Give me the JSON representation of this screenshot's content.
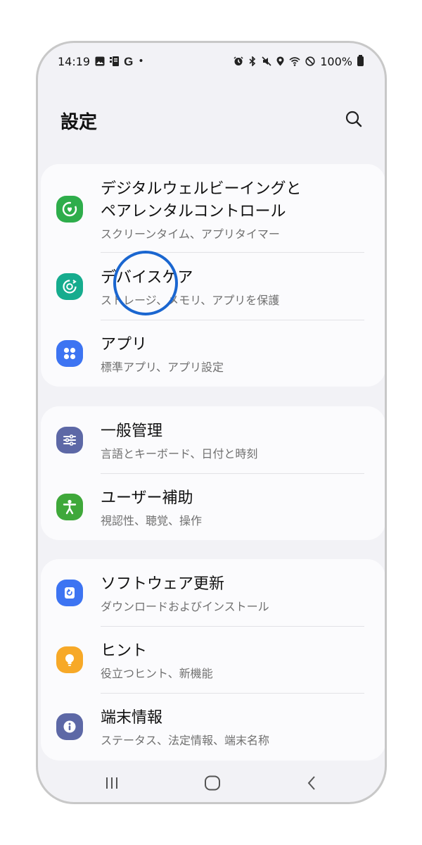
{
  "status_bar": {
    "time": "14:19",
    "carrier_glyph": "G",
    "dot": "•",
    "battery_pct": "100%",
    "icons_left": [
      "image-icon",
      "sim-icon",
      "google-icon",
      "dot-icon"
    ],
    "icons_right": [
      "alarm-icon",
      "bluetooth-icon",
      "mute-icon",
      "location-icon",
      "wifi-icon",
      "dnd-icon",
      "battery-icon"
    ]
  },
  "header": {
    "title": "設定"
  },
  "groups": [
    {
      "items": [
        {
          "title_line1": "デジタルウェルビーイングと",
          "title_line2": "ペアレンタルコントロール",
          "subtitle": "スクリーンタイム、アプリタイマー",
          "icon": "digital-wellbeing-icon",
          "color": "#2ead4b"
        },
        {
          "title": "デバイスケア",
          "subtitle": "ストレージ、メモリ、アプリを保護",
          "icon": "device-care-icon",
          "color": "#16ac8e"
        },
        {
          "title": "アプリ",
          "subtitle": "標準アプリ、アプリ設定",
          "icon": "apps-icon",
          "color": "#3d74f2"
        }
      ]
    },
    {
      "items": [
        {
          "title": "一般管理",
          "subtitle": "言語とキーボード、日付と時刻",
          "icon": "general-management-icon",
          "color": "#5d68a6"
        },
        {
          "title": "ユーザー補助",
          "subtitle": "視認性、聴覚、操作",
          "icon": "accessibility-icon",
          "color": "#3fa83a"
        }
      ]
    },
    {
      "items": [
        {
          "title": "ソフトウェア更新",
          "subtitle": "ダウンロードおよびインストール",
          "icon": "software-update-icon",
          "color": "#3d74f2"
        },
        {
          "title": "ヒント",
          "subtitle": "役立つヒント、新機能",
          "icon": "tips-icon",
          "color": "#f7a928"
        },
        {
          "title": "端末情報",
          "subtitle": "ステータス、法定情報、端末名称",
          "icon": "about-phone-icon",
          "color": "#5d68a6"
        }
      ]
    }
  ],
  "navbar": {
    "buttons": [
      "recent-apps-icon",
      "home-icon",
      "back-icon"
    ]
  },
  "colors": {
    "background": "#f2f2f6",
    "card": "#fbfbfd",
    "tap_indicator": "#1a66d0"
  }
}
